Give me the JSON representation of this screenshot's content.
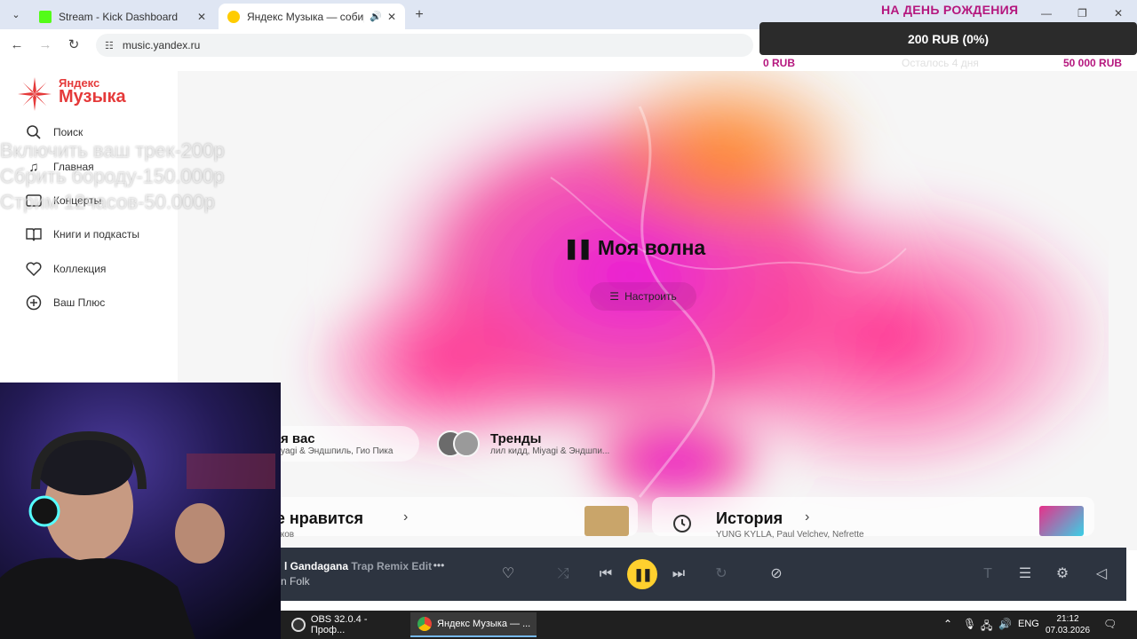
{
  "browser": {
    "tabs": [
      {
        "title": "Stream - Kick Dashboard",
        "favicon_color": "#53fc18",
        "active": false
      },
      {
        "title": "Яндекс Музыка — собирае",
        "favicon_color": "#ffcc00",
        "active": true
      }
    ],
    "url": "music.yandex.ru"
  },
  "donation": {
    "title": "НА ДЕНЬ РОЖДЕНИЯ",
    "amount": "200 RUB (0%)",
    "min": "0 RUB",
    "remaining": "Осталось 4 дня",
    "max": "50 000 RUB",
    "progress_percent": 0
  },
  "overlay_lines": [
    "Включить ваш трек-200р",
    "Сбрить бороду-150.000р",
    "Стрим 12часов-50.000р"
  ],
  "sidebar": {
    "logo_small": "Яндекс",
    "logo_big": "Музыка",
    "items": [
      {
        "label": "Поиск",
        "icon": "search-icon"
      },
      {
        "label": "Главная",
        "icon": "music-note-icon"
      },
      {
        "label": "Концерты",
        "icon": "ticket-icon"
      },
      {
        "label": "Книги и подкасты",
        "icon": "book-icon"
      },
      {
        "label": "Коллекция",
        "icon": "heart-icon"
      },
      {
        "label": "Ваш Плюс",
        "icon": "plus-circle-icon"
      }
    ]
  },
  "hero": {
    "title": "Моя волна",
    "setup_label": "Настроить"
  },
  "pills": {
    "for_you_title": "я вас",
    "for_you_sub": "yagi & Эндшпиль, Гио Пика",
    "trends_title": "Тренды",
    "trends_sub": "лил кидд, Miyagi & Эндшпи..."
  },
  "cards": {
    "likes_title": "не нравится",
    "likes_sub": "треков",
    "history_title": "История",
    "history_sub": "YUNG KYLLA, Paul Velchev, Nefrette"
  },
  "player": {
    "track_title": "l Gandagana",
    "track_mix": "Trap Remix Edit",
    "track_artist": "n Folk"
  },
  "taskbar": {
    "tasks": [
      {
        "label": "OBS 32.0.4 - Проф...",
        "icon_color": "#333333"
      },
      {
        "label": "Яндекс Музыка — ...",
        "icon_color": "#e94235"
      }
    ],
    "lang": "ENG",
    "time": "21:12",
    "date": "07.03.2026"
  },
  "colors": {
    "brand_red": "#e53a3a",
    "donation_pink": "#b5177e",
    "player_bg": "#2d3440",
    "play_yellow": "#ffd02e"
  }
}
